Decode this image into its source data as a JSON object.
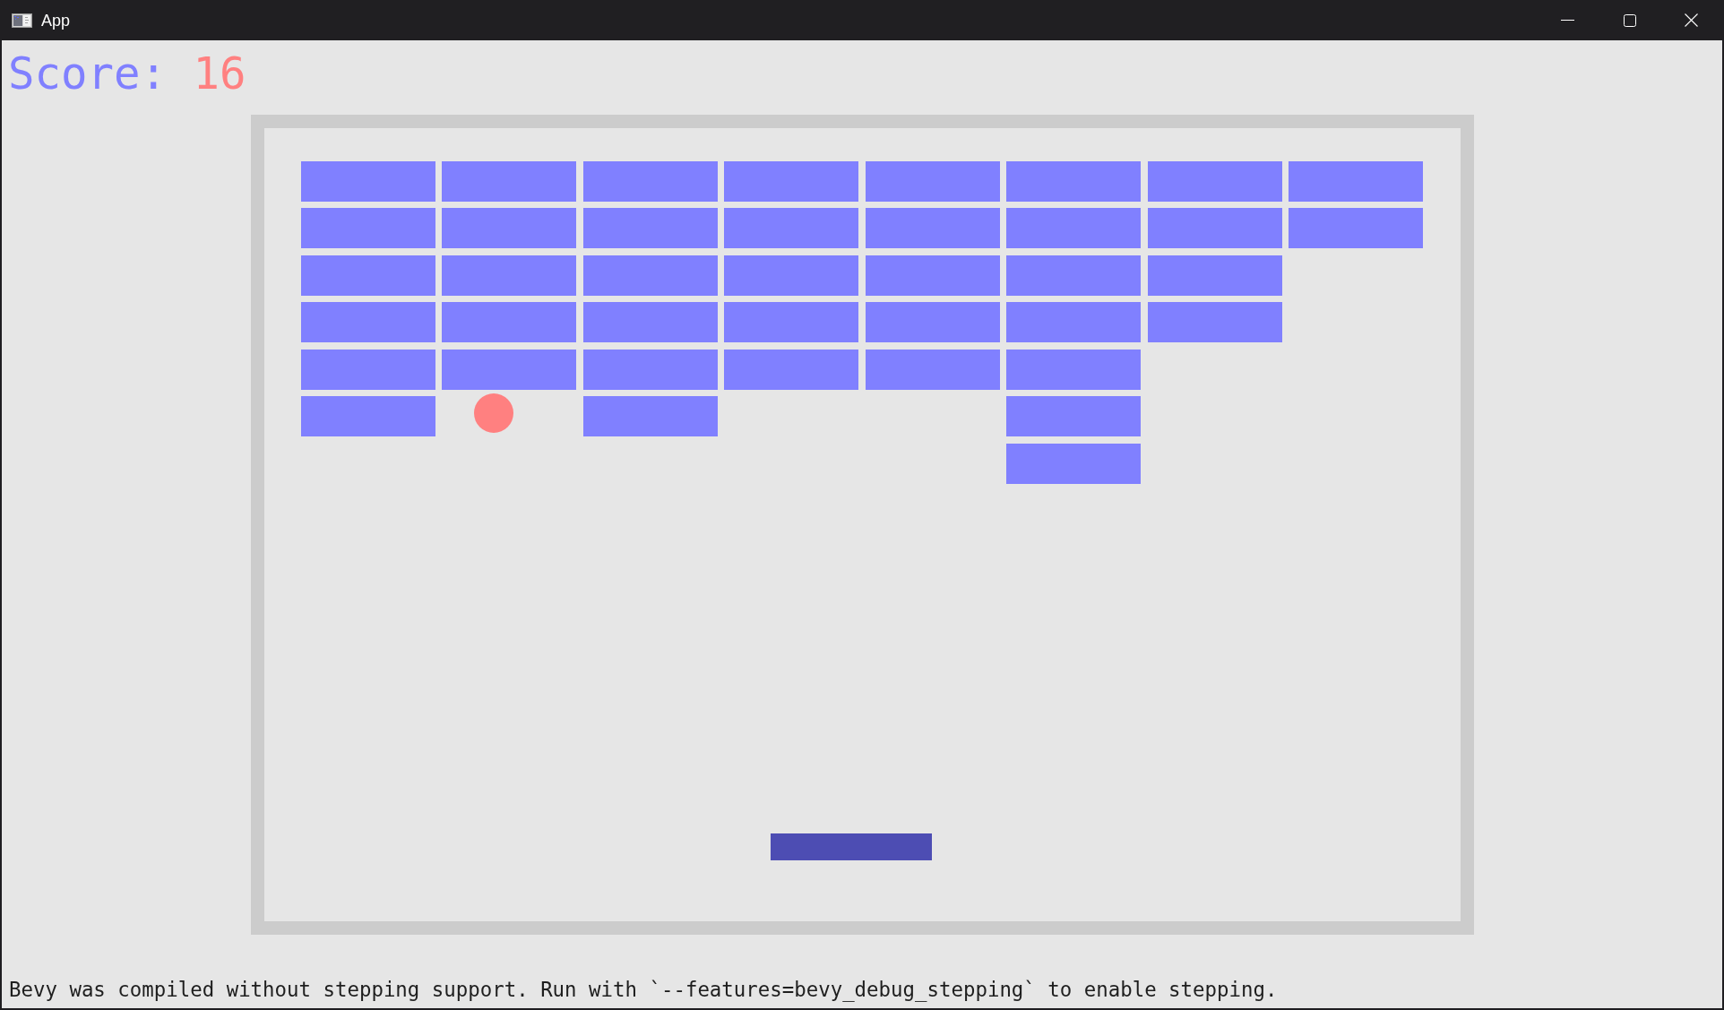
{
  "window": {
    "title": "App"
  },
  "scoreboard": {
    "label": "Score:",
    "value": "16"
  },
  "brick_rows": [
    {
      "bricks": [
        {
          "present": true
        },
        {
          "present": true
        },
        {
          "present": true
        },
        {
          "present": true
        },
        {
          "present": true
        },
        {
          "present": true
        },
        {
          "present": true
        },
        {
          "present": true
        }
      ]
    },
    {
      "bricks": [
        {
          "present": true
        },
        {
          "present": true
        },
        {
          "present": true
        },
        {
          "present": true
        },
        {
          "present": true
        },
        {
          "present": true
        },
        {
          "present": true
        },
        {
          "present": true
        }
      ]
    },
    {
      "bricks": [
        {
          "present": true
        },
        {
          "present": true
        },
        {
          "present": true
        },
        {
          "present": true
        },
        {
          "present": true
        },
        {
          "present": true
        },
        {
          "present": true
        },
        {
          "present": false
        }
      ]
    },
    {
      "bricks": [
        {
          "present": true
        },
        {
          "present": true
        },
        {
          "present": true
        },
        {
          "present": true
        },
        {
          "present": true
        },
        {
          "present": true
        },
        {
          "present": true
        },
        {
          "present": false
        }
      ]
    },
    {
      "bricks": [
        {
          "present": true
        },
        {
          "present": true
        },
        {
          "present": true
        },
        {
          "present": true
        },
        {
          "present": true
        },
        {
          "present": true
        },
        {
          "present": false
        },
        {
          "present": false
        }
      ]
    },
    {
      "bricks": [
        {
          "present": true
        },
        {
          "present": false
        },
        {
          "present": true
        },
        {
          "present": false
        },
        {
          "present": false
        },
        {
          "present": true
        },
        {
          "present": false
        },
        {
          "present": false
        }
      ]
    },
    {
      "bricks": [
        {
          "present": false
        },
        {
          "present": false
        },
        {
          "present": false
        },
        {
          "present": false
        },
        {
          "present": false
        },
        {
          "present": true
        },
        {
          "present": false
        },
        {
          "present": false
        }
      ]
    }
  ],
  "message": "Bevy was compiled without stepping support. Run with `--features=bevy_debug_stepping` to enable stepping."
}
